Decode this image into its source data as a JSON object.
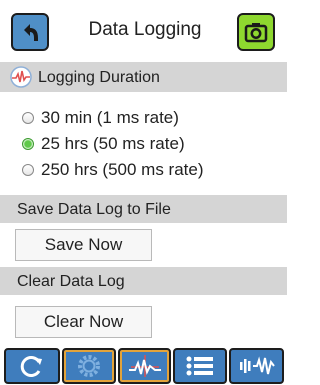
{
  "header": {
    "title": "Data Logging",
    "back_icon": "back-arrow-icon",
    "camera_icon": "camera-icon"
  },
  "logging_duration": {
    "label": "Logging Duration",
    "icon": "waveform-icon",
    "options": [
      {
        "label": "30 min (1 ms rate)",
        "selected": false
      },
      {
        "label": "25 hrs (50 ms rate)",
        "selected": true
      },
      {
        "label": "250 hrs (500 ms rate)",
        "selected": false
      }
    ]
  },
  "save_section": {
    "label": "Save Data Log to File",
    "button_label": "Save Now"
  },
  "clear_section": {
    "label": "Clear Data Log",
    "button_label": "Clear Now"
  },
  "bottom_tabs": [
    {
      "icon": "refresh-icon",
      "active": false
    },
    {
      "icon": "settings-gear-icon",
      "active": true
    },
    {
      "icon": "waveform-cursor-icon",
      "active": true
    },
    {
      "icon": "list-menu-icon",
      "active": false
    },
    {
      "icon": "audio-waveform-icon",
      "active": false
    }
  ],
  "colors": {
    "back_button": "#4f8fc7",
    "camera_button": "#8ed82f",
    "header_band": "#d5d5d5",
    "tab_background": "#3f7dbd",
    "tab_active_highlight": "#e3a33a",
    "radio_selected": "#5fc94a"
  }
}
